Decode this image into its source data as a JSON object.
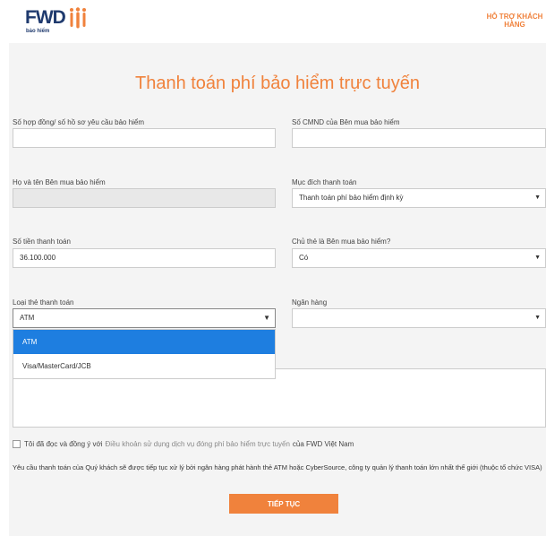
{
  "header": {
    "logo_text": "FWD",
    "logo_sub": "bảo hiểm",
    "support_line1": "HỖ TRỢ KHÁCH",
    "support_line2": "HÀNG"
  },
  "page_title": "Thanh toán phí bảo hiểm trực tuyến",
  "form": {
    "contract_label": "Số hợp đồng/ số hồ sơ yêu cầu bảo hiểm",
    "contract_value": "",
    "id_label": "Số CMND của Bên mua bảo hiểm",
    "id_value": "",
    "name_label": "Họ và tên Bên mua bảo hiểm",
    "name_value": "",
    "purpose_label": "Mục đích thanh toán",
    "purpose_value": "Thanh toán phí bảo hiểm định kỳ",
    "amount_label": "Số tiền thanh toán",
    "amount_value": "36.100.000",
    "holder_label": "Chủ thẻ là Bên mua bảo hiểm?",
    "holder_value": "Có",
    "card_type_label": "Loại thẻ thanh toán",
    "card_type_value": "ATM",
    "bank_label": "Ngân hàng",
    "bank_value": ""
  },
  "dropdown_options": [
    "ATM",
    "Visa/MasterCard/JCB"
  ],
  "agree": {
    "prefix": "Tôi đã đọc và đồng ý với",
    "link": "Điều khoản sử dụng dịch vụ đóng phí bảo hiểm trực tuyến",
    "suffix": "của FWD Việt Nam"
  },
  "notice": "Yêu cầu thanh toán của Quý khách sẽ được tiếp tục xử lý bởi ngân hàng phát hành thẻ ATM hoặc CyberSource, công ty quản lý thanh toán lớn nhất thế giới (thuộc tổ chức VISA)",
  "submit_label": "TIẾP TỤC",
  "colors": {
    "accent": "#f0823c",
    "brand": "#1f3a6e",
    "selected": "#1e7ee0"
  }
}
